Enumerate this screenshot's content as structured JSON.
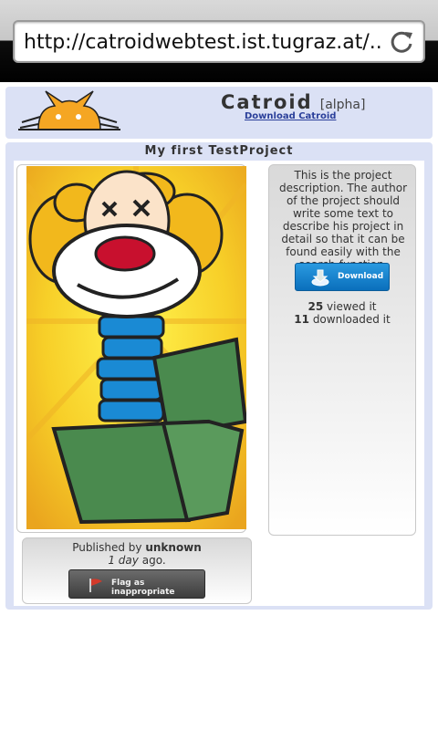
{
  "browser": {
    "url": "http://catroidwebtest.ist.tugraz.at/..."
  },
  "header": {
    "title": "Catroid",
    "tag": "[alpha]",
    "download_link": "Download Catroid"
  },
  "project": {
    "title": "My first TestProject",
    "description": "This is the project description. The author of the project should write some text to describe his project in detail so that it can be found easily with the search-function.",
    "download_button": "Download",
    "views_count": "25",
    "views_label": "viewed it",
    "downloads_count": "11",
    "downloads_label": "downloaded it",
    "published_prefix": "Published by",
    "author": "unknown",
    "age": "1 day",
    "age_suffix": "ago.",
    "flag_button": "Flag as inappropriate"
  },
  "colors": {
    "panel_bg": "#dbe1f5",
    "download_button": "#1a86d0",
    "flag_button": "#4d4d4d",
    "logo_orange": "#f5a623"
  },
  "icons": [
    "refresh-icon",
    "catroid-logo",
    "download-icon",
    "flag-icon"
  ]
}
